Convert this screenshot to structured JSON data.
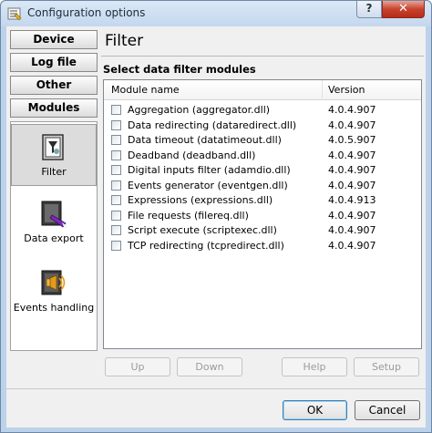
{
  "window": {
    "title": "Configuration options",
    "help_label": "?",
    "close_label": "✕"
  },
  "sidebar": {
    "tabs": [
      {
        "label": "Device"
      },
      {
        "label": "Log file"
      },
      {
        "label": "Other"
      },
      {
        "label": "Modules"
      }
    ],
    "items": [
      {
        "label": "Filter",
        "icon": "filter-icon",
        "selected": true
      },
      {
        "label": "Data export",
        "icon": "data-export-icon",
        "selected": false
      },
      {
        "label": "Events handling",
        "icon": "events-handling-icon",
        "selected": false
      }
    ]
  },
  "main": {
    "title": "Filter",
    "subtitle": "Select data filter modules",
    "columns": [
      "Module name",
      "Version"
    ],
    "modules": [
      {
        "name": "Aggregation (aggregator.dll)",
        "version": "4.0.4.907",
        "checked": false
      },
      {
        "name": "Data redirecting (dataredirect.dll)",
        "version": "4.0.4.907",
        "checked": false
      },
      {
        "name": "Data timeout (datatimeout.dll)",
        "version": "4.0.5.907",
        "checked": false
      },
      {
        "name": "Deadband (deadband.dll)",
        "version": "4.0.4.907",
        "checked": false
      },
      {
        "name": "Digital inputs filter (adamdio.dll)",
        "version": "4.0.4.907",
        "checked": false
      },
      {
        "name": "Events generator (eventgen.dll)",
        "version": "4.0.4.907",
        "checked": false
      },
      {
        "name": "Expressions (expressions.dll)",
        "version": "4.0.4.913",
        "checked": false
      },
      {
        "name": "File requests (filereq.dll)",
        "version": "4.0.4.907",
        "checked": false
      },
      {
        "name": "Script execute (scriptexec.dll)",
        "version": "4.0.4.907",
        "checked": false
      },
      {
        "name": "TCP redirecting (tcpredirect.dll)",
        "version": "4.0.4.907",
        "checked": false
      }
    ],
    "buttons": {
      "up": "Up",
      "down": "Down",
      "help": "Help",
      "setup": "Setup"
    }
  },
  "footer": {
    "ok": "OK",
    "cancel": "Cancel"
  },
  "colors": {
    "frame": "#bcd2ea",
    "close": "#c7432f"
  }
}
